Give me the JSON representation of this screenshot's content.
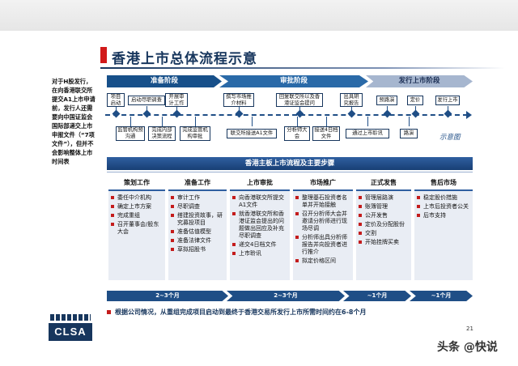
{
  "title": "香港上市总体流程示意",
  "side_note": "对于H股发行，在向香港联交所提交A1上市申请前，发行人还需要向中国证监会国际部递交上市申报文件（“7项文件”），但并不会影响整体上市时间表",
  "phases": [
    "准备阶段",
    "审批阶段",
    "发行上市阶段"
  ],
  "schedule_label": "示意图",
  "top_steps": [
    "项目启动",
    "启动尽职调查",
    "开展审计工作",
    "撰写市场推介材料",
    "回复联交所以及香港证监会提问",
    "出具研究报告",
    "预路演",
    "定价",
    "发行上市"
  ],
  "bottom_steps": [
    "监管机构预沟通",
    "完成内部决策流程",
    "完成监管机构审批",
    "联交所接送A1文件",
    "分析师大会",
    "接送4日档文件",
    "通过上市聆讯",
    "路演"
  ],
  "section_banner": "香港主板上市流程及主要步骤",
  "columns": [
    {
      "header": "策划工作",
      "items": [
        "委任中介机构",
        "确定上市方案",
        "完成重组",
        "召开董事会/股东大会"
      ]
    },
    {
      "header": "准备工作",
      "items": [
        "审计工作",
        "尽职调查",
        "搭建投资故事，研究募投项目",
        "准备估值模型",
        "准备法律文件",
        "草拟招股书"
      ]
    },
    {
      "header": "上市审批",
      "items": [
        "向香港联交所提交A1文件",
        "就香港联交所和香港证监会提出的问题做出回应及补充尽职调查",
        "递交4日档文件",
        "上市聆讯"
      ]
    },
    {
      "header": "市场推广",
      "items": [
        "整理基石投资者名单并开始接触",
        "召开分析师大会并邀请分析师进行现场尽调",
        "分析师出具分析师报告并向投资者进行推介",
        "拟定价格区间"
      ]
    },
    {
      "header": "正式发售",
      "items": [
        "管理层路演",
        "账簿管理",
        "公开发售",
        "定价及分配股份",
        "交割",
        "开始挂牌买卖"
      ]
    },
    {
      "header": "售后市场",
      "items": [
        "稳定股价措施",
        "上市后投资者公关",
        "后市支持"
      ]
    }
  ],
  "durations": [
    "2~3个月",
    "2~3个月",
    "~1个月",
    "~1个月"
  ],
  "footnote": "根据公司情况，从重组完成项目启动到最终于香港交易所发行上市所需时间约在6-8个月",
  "logo_text": "CLSA",
  "page_number": "21",
  "watermark": "头条 @快说",
  "colors": {
    "primary": "#17365d",
    "accent": "#c41c1c",
    "phase_light": "#a6b6cf"
  }
}
